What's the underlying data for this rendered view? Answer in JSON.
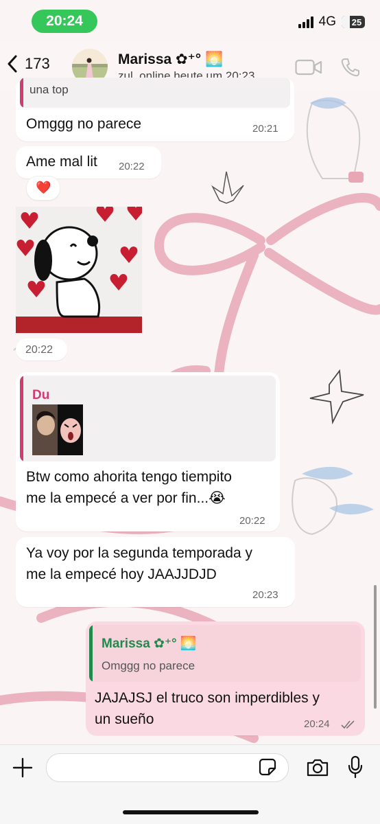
{
  "status_bar": {
    "time": "20:24",
    "network": "4G",
    "battery": "25"
  },
  "header": {
    "back_count": "173",
    "contact_name": "Marissa ✿⁺°",
    "contact_emoji": "🌅",
    "last_seen": "zul. online heute um 20:23"
  },
  "messages": [
    {
      "quote_text": "una top",
      "text": "Omggg no parece",
      "time": "20:21"
    },
    {
      "text": "Ame mal lit",
      "time": "20:22"
    },
    {
      "reaction": "❤️"
    },
    {
      "sticker": "snoopy-hearts-sticker",
      "time": "20:22"
    },
    {
      "quote_author": "Du",
      "text_line1": "Btw como ahorita tengo tiempito",
      "text_line2": "me la empecé a ver por fin...",
      "emoji": "😭",
      "time": "20:22"
    },
    {
      "text_line1": "Ya voy por la segunda temporada y",
      "text_line2": "me la empecé hoy JAAJJDJD",
      "time": "20:23"
    },
    {
      "quote_author": "Marissa ✿⁺°",
      "quote_author_emoji": "🌅",
      "quote_text": "Omggg no parece",
      "text_line1": "JAJAJSJ el truco son imperdibles y",
      "text_line2": "un sueño",
      "time": "20:24",
      "status": "read"
    }
  ],
  "colors": {
    "accent_green": "#35c759",
    "quote_pink": "#d13b72",
    "quote_green": "#1e8a4c",
    "outgoing_bubble": "#fbd9e2"
  },
  "icons": [
    "chevron-left-icon",
    "video-call-icon",
    "phone-icon",
    "plus-icon",
    "sticker-icon",
    "camera-icon",
    "microphone-icon",
    "double-check-icon"
  ]
}
